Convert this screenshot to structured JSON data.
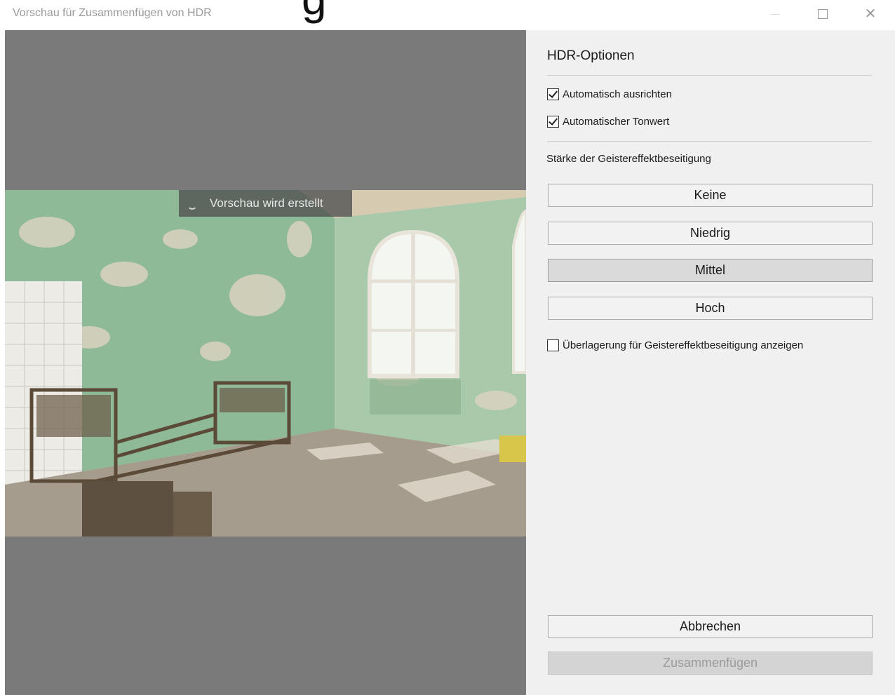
{
  "window": {
    "title": "Vorschau für Zusammenfügen von HDR",
    "title_fragment": "g",
    "controls": [
      "minimize",
      "maximize",
      "close"
    ]
  },
  "preview": {
    "status": "Vorschau wird erstellt",
    "background_color": "#7a7a7a"
  },
  "options": {
    "heading": "HDR-Optionen",
    "auto_align": {
      "label": "Automatisch ausrichten",
      "checked": true
    },
    "auto_tone": {
      "label": "Automatischer Tonwert",
      "checked": true
    },
    "deghost_label": "Stärke der Geistereffektbeseitigung",
    "deghost_levels": [
      {
        "label": "Keine",
        "selected": false
      },
      {
        "label": "Niedrig",
        "selected": false
      },
      {
        "label": "Mittel",
        "selected": true
      },
      {
        "label": "Hoch",
        "selected": false
      }
    ],
    "overlay": {
      "label": "Überlagerung für Geistereffektbeseitigung anzeigen",
      "checked": false
    }
  },
  "actions": {
    "cancel": "Abbrechen",
    "merge": "Zusammenfügen",
    "merge_enabled": false
  }
}
